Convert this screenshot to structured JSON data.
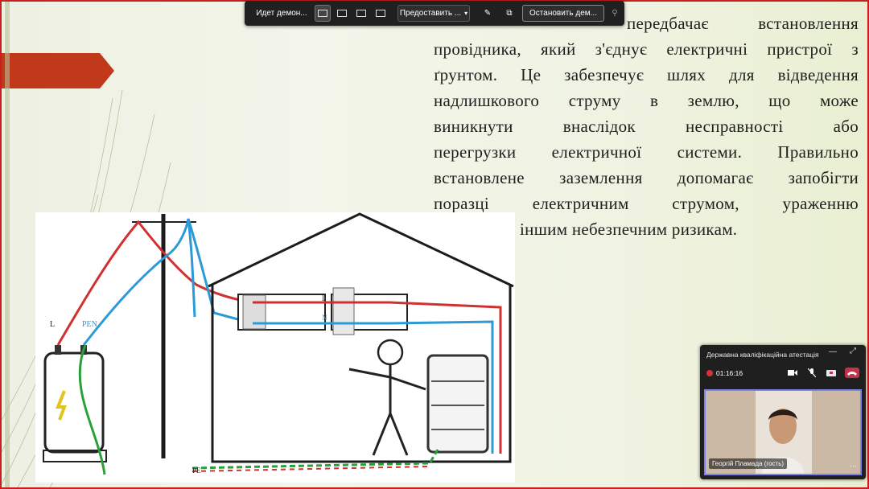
{
  "slide": {
    "lines": [
      "передбачає встановлення",
      "провідника, який з'єднує електричні пристрої з",
      "ґрунтом. Це забезпечує шлях для відведення",
      "надлишкового струму в землю, що може",
      "виникнути внаслідок несправності або",
      "перегрузки електричної системи. Правильно",
      "встановлене заземлення допомагає запобігти",
      "поразці електричним струмом, ураженню",
      "вогнем або іншим небезпечним ризикам."
    ],
    "diagram": {
      "label_l_pole": "L",
      "label_pen": "PEN",
      "label_l_house": "L",
      "label_n_house": "N",
      "label_pe": "PE",
      "colors": {
        "phase": "#d03030",
        "neutral": "#2b9ad6",
        "earth": "#2aa03a"
      }
    }
  },
  "share_toolbar": {
    "title": "Идет демон...",
    "give_control": "Предоставить ...",
    "stop": "Остановить дем...",
    "pin_icon": "pin-icon"
  },
  "mini_window": {
    "title": "Державна кваліфікаційна атестація",
    "timer": "01:16:16",
    "participant": "Георгій Пламада (гость)",
    "more": "···",
    "end_color": "#c4314b"
  }
}
